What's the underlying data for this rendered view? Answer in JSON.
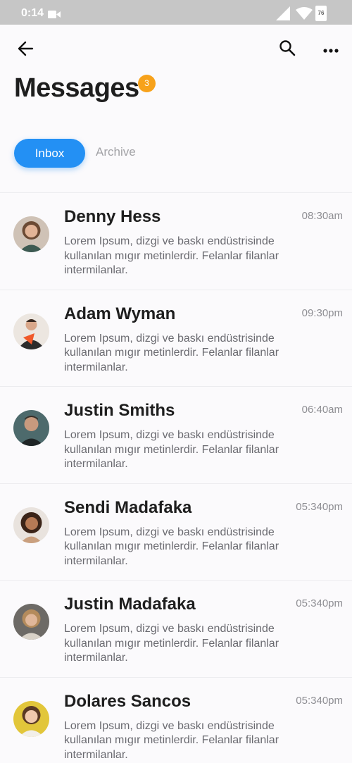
{
  "status_bar": {
    "time": "0:14",
    "battery": "76",
    "icons": [
      "video-camera-icon",
      "signal-icon",
      "wifi-icon",
      "battery-icon"
    ]
  },
  "header": {
    "icons": [
      "back-arrow-icon",
      "search-icon",
      "more-dots-icon"
    ],
    "title": "Messages",
    "badge_count": "3"
  },
  "tabs": {
    "inbox": "Inbox",
    "archive": "Archive",
    "active": "Inbox"
  },
  "messages": [
    {
      "name": "Denny Hess",
      "time": "08:30am",
      "preview": "Lorem Ipsum, dizgi ve baskı endüstrisinde kullanılan mıgır metinlerdir. Felanlar filanlar intermilanlar."
    },
    {
      "name": "Adam Wyman",
      "time": "09:30pm",
      "preview": "Lorem Ipsum, dizgi ve baskı endüstrisinde kullanılan mıgır metinlerdir. Felanlar filanlar intermilanlar."
    },
    {
      "name": "Justin Smiths",
      "time": "06:40am",
      "preview": "Lorem Ipsum, dizgi ve baskı endüstrisinde kullanılan mıgır metinlerdir. Felanlar filanlar intermilanlar."
    },
    {
      "name": "Sendi Madafaka",
      "time": "05:340pm",
      "preview": "Lorem Ipsum, dizgi ve baskı endüstrisinde kullanılan mıgır metinlerdir. Felanlar filanlar intermilanlar."
    },
    {
      "name": "Justin Madafaka",
      "time": "05:340pm",
      "preview": "Lorem Ipsum, dizgi ve baskı endüstrisinde kullanılan mıgır metinlerdir. Felanlar filanlar intermilanlar."
    },
    {
      "name": "Dolares Sancos",
      "time": "05:340pm",
      "preview": "Lorem Ipsum, dizgi ve baskı endüstrisinde kullanılan mıgır metinlerdir. Felanlar filanlar intermilanlar."
    }
  ],
  "colors": {
    "accent": "#2390f4",
    "badge": "#f7a21b",
    "status_bar": "#c6c6c6",
    "background": "#fbfafc"
  }
}
